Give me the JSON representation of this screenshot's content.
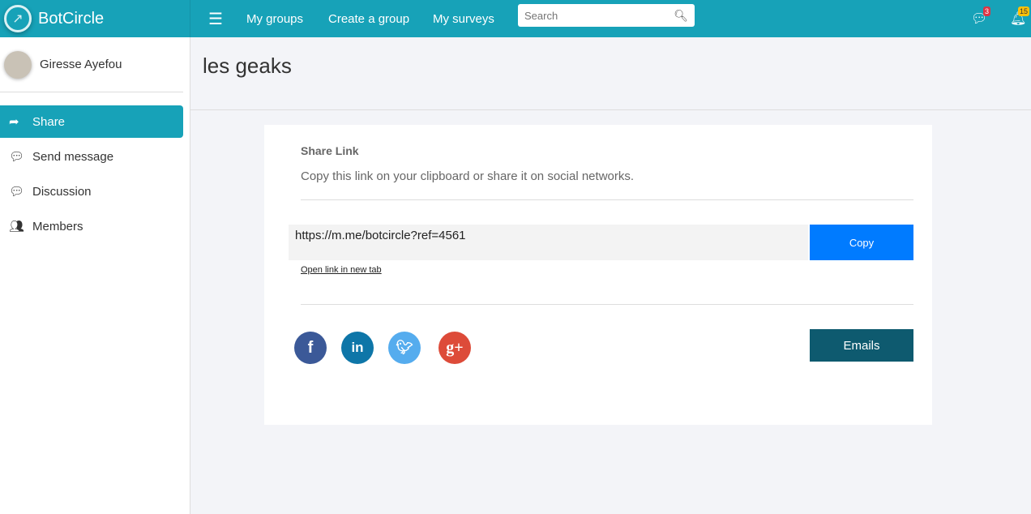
{
  "brand": "BotCircle",
  "nav": {
    "my_groups": "My groups",
    "create_group": "Create a group",
    "my_surveys": "My surveys",
    "search_placeholder": "Search",
    "messages_count": "3",
    "notifications_count": "15"
  },
  "user": {
    "name": "Giresse Ayefou"
  },
  "sidebar": {
    "items": [
      {
        "label": "Share"
      },
      {
        "label": "Send message"
      },
      {
        "label": "Discussion"
      },
      {
        "label": "Members"
      }
    ]
  },
  "page": {
    "title": "les geaks"
  },
  "share": {
    "heading": "Share Link",
    "description": "Copy this link on your clipboard or share it on social networks.",
    "link": "https://m.me/botcircle?ref=4561",
    "copy_label": "Copy",
    "open_link": "Open link in new tab",
    "emails_label": "Emails"
  },
  "colors": {
    "primary": "#17a2b8",
    "copy": "#007bff",
    "emails": "#0e5a6f"
  }
}
